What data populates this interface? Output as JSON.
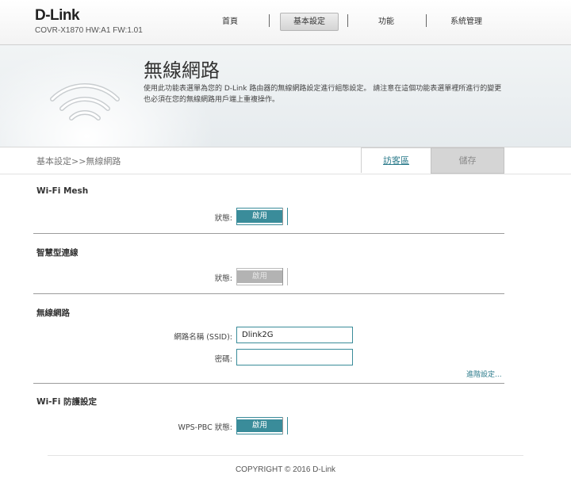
{
  "brand": {
    "logo": "D-Link",
    "model": "COVR-X1870 HW:A1 FW:1.01"
  },
  "nav": {
    "items": [
      "首頁",
      "基本設定",
      "功能",
      "系統管理"
    ],
    "active": "基本設定"
  },
  "banner": {
    "title": "無線網路",
    "description": "使用此功能表選單為您的 D-Link 路由器的無線網路設定進行組態設定。 請注意在這個功能表選單裡所進行的變更也必須在您的無線網路用戶端上重複操作。",
    "icon": "wifi-icon"
  },
  "breadcrumb": "基本設定>>無線網路",
  "actions": {
    "guest_zone": "訪客區",
    "save": "儲存"
  },
  "wifi_mesh": {
    "title": "Wi-Fi Mesh",
    "status_label": "狀態:",
    "toggle_label": "啟用",
    "enabled": true
  },
  "smart_connect": {
    "title": "智慧型連線",
    "status_label": "狀態:",
    "toggle_label": "啟用",
    "enabled": false
  },
  "wireless": {
    "title": "無線網路",
    "ssid_label": "網路名稱 (SSID):",
    "ssid_value": "Dlink2G",
    "password_label": "密碼:",
    "password_value": "",
    "advanced_link": "進階設定..."
  },
  "wifi_protected": {
    "title": "Wi-Fi 防護設定",
    "wps_label": "WPS-PBC 狀態:",
    "toggle_label": "啟用",
    "enabled": true
  },
  "footer": {
    "copyright": "COPYRIGHT © 2016 D-Link"
  },
  "colors": {
    "accent": "#3a8c9a",
    "disabled": "#b3b3b3"
  }
}
